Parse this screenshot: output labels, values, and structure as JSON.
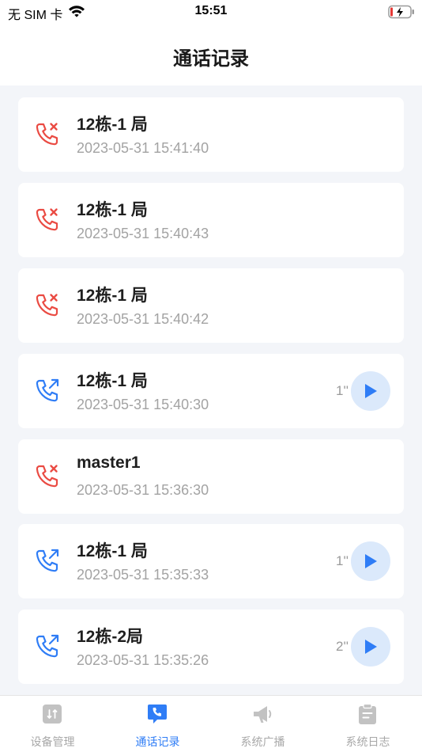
{
  "status_bar": {
    "carrier": "无 SIM 卡",
    "time": "15:51"
  },
  "nav": {
    "title": "通话记录"
  },
  "colors": {
    "missed": "#ea4b43",
    "outgoing": "#2f7df6",
    "play_bg": "#dbe9fb",
    "tab_active": "#2f7df6",
    "tab_inactive": "#c2c2c2"
  },
  "calls": [
    {
      "type": "missed",
      "icon": "missed-call-icon",
      "name": "12栋-1 局",
      "time": "2023-05-31 15:41:40"
    },
    {
      "type": "missed",
      "icon": "missed-call-icon",
      "name": "12栋-1 局",
      "time": "2023-05-31 15:40:43"
    },
    {
      "type": "missed",
      "icon": "missed-call-icon",
      "name": "12栋-1 局",
      "time": "2023-05-31 15:40:42"
    },
    {
      "type": "outgoing",
      "icon": "outgoing-call-icon",
      "name": "12栋-1 局",
      "time": "2023-05-31 15:40:30",
      "duration": "1''"
    },
    {
      "type": "missed",
      "icon": "missed-call-icon",
      "name": "master1",
      "time": "2023-05-31 15:36:30"
    },
    {
      "type": "outgoing",
      "icon": "outgoing-call-icon",
      "name": "12栋-1 局",
      "time": "2023-05-31 15:35:33",
      "duration": "1''"
    },
    {
      "type": "outgoing",
      "icon": "outgoing-call-icon",
      "name": "12栋-2局",
      "time": "2023-05-31 15:35:26",
      "duration": "2''"
    }
  ],
  "tabs": [
    {
      "label": "设备管理",
      "icon": "device-management-icon",
      "active": false
    },
    {
      "label": "通话记录",
      "icon": "call-record-icon",
      "active": true
    },
    {
      "label": "系统广播",
      "icon": "broadcast-icon",
      "active": false
    },
    {
      "label": "系统日志",
      "icon": "system-log-icon",
      "active": false
    }
  ]
}
